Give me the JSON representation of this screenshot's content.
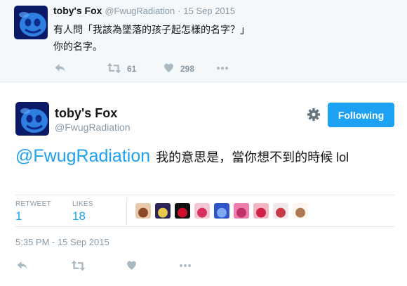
{
  "parent_tweet": {
    "display_name": "toby's Fox",
    "handle": "@FwugRadiation",
    "separator": "·",
    "date": "15 Sep 2015",
    "text_lines": [
      "有人問「我該為墜落的孩子起怎樣的名字？」",
      "你的名字。"
    ],
    "actions": {
      "retweet_count": "61",
      "like_count": "298"
    }
  },
  "main_tweet": {
    "display_name": "toby's Fox",
    "handle": "@FwugRadiation",
    "follow_button": "Following",
    "mention": "@FwugRadiation",
    "text": "我的意思是，當你想不到的時候 lol",
    "stats": {
      "retweets_label": "RETWEET",
      "retweets_count": "1",
      "likes_label": "LIKES",
      "likes_count": "18"
    },
    "liked_by_avatars": [
      {
        "bg": "#e8c9a8",
        "fg": "#8a4a2a"
      },
      {
        "bg": "#2c2456",
        "fg": "#e8c84a"
      },
      {
        "bg": "#111111",
        "fg": "#d0102a"
      },
      {
        "bg": "#f4c6d4",
        "fg": "#d6305f"
      },
      {
        "bg": "#2b55c8",
        "fg": "#7fa8f0"
      },
      {
        "bg": "#f07cb0",
        "fg": "#c0306a"
      },
      {
        "bg": "#f3b6c2",
        "fg": "#d01f45"
      },
      {
        "bg": "#f2e8ea",
        "fg": "#c73a4a"
      },
      {
        "bg": "#fdf6ef",
        "fg": "#b07850"
      }
    ],
    "timestamp": "5:35 PM - 15 Sep 2015"
  },
  "icons": {
    "reply": "reply-icon",
    "retweet": "retweet-icon",
    "like": "heart-icon",
    "more": "more-icon",
    "settings": "gear-icon"
  },
  "colors": {
    "accent": "#1da1f2",
    "text": "#14171a",
    "muted": "#8899a6",
    "icon": "#aab8c2",
    "border": "#e1e8ed",
    "parent_background": "#f5f8fa"
  }
}
